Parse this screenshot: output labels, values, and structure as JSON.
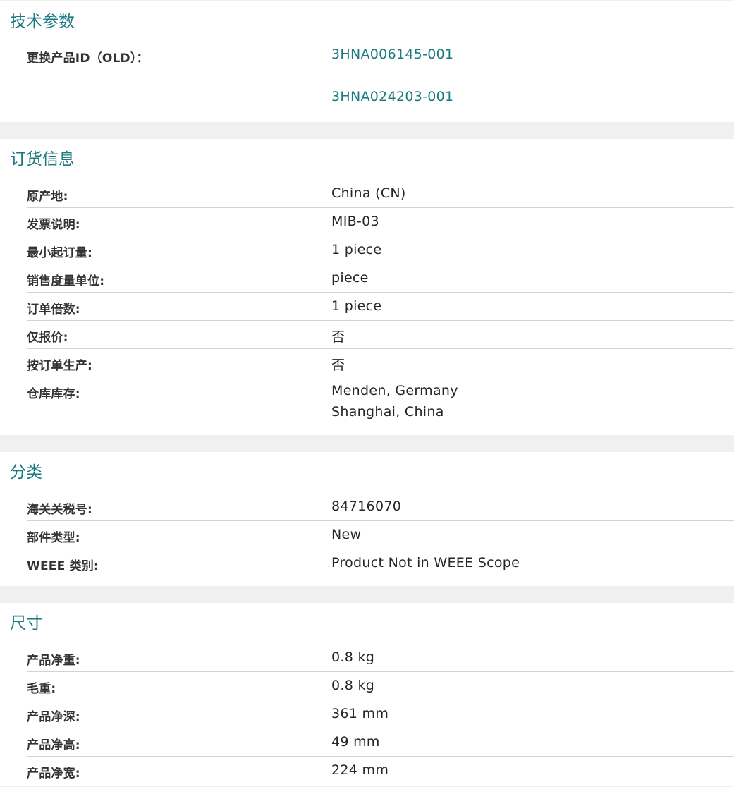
{
  "sections": {
    "tech": {
      "title": "技术参数",
      "rows": [
        {
          "label": "更换产品ID（OLD）：",
          "values": [
            "3HNA006145-001",
            "3HNA024203-001"
          ]
        }
      ]
    },
    "order": {
      "title": "订货信息",
      "rows": [
        {
          "label": "原产地:",
          "value": "China (CN)"
        },
        {
          "label": "发票说明:",
          "value": "MIB-03"
        },
        {
          "label": "最小起订量:",
          "value": "1 piece"
        },
        {
          "label": "销售度量单位:",
          "value": "piece"
        },
        {
          "label": "订单倍数:",
          "value": "1 piece"
        },
        {
          "label": "仅报价:",
          "value": "否"
        },
        {
          "label": "按订单生产:",
          "value": "否"
        },
        {
          "label": "仓库库存:",
          "values": [
            "Menden, Germany",
            "Shanghai, China"
          ]
        }
      ]
    },
    "classification": {
      "title": "分类",
      "rows": [
        {
          "label": "海关关税号:",
          "value": "84716070"
        },
        {
          "label": "部件类型:",
          "value": "New"
        },
        {
          "label": "WEEE 类别:",
          "value": "Product Not in WEEE Scope"
        }
      ]
    },
    "dimensions": {
      "title": "尺寸",
      "rows": [
        {
          "label": "产品净重:",
          "value": "0.8 kg"
        },
        {
          "label": "毛重:",
          "value": "0.8 kg"
        },
        {
          "label": "产品净深:",
          "value": "361 mm"
        },
        {
          "label": "产品净高:",
          "value": "49 mm"
        },
        {
          "label": "产品净宽:",
          "value": "224 mm"
        }
      ]
    }
  },
  "colors": {
    "accent": "#1a7a80",
    "background": "#f0f0f0",
    "panel": "#ffffff",
    "divider": "#d2d2d2"
  }
}
